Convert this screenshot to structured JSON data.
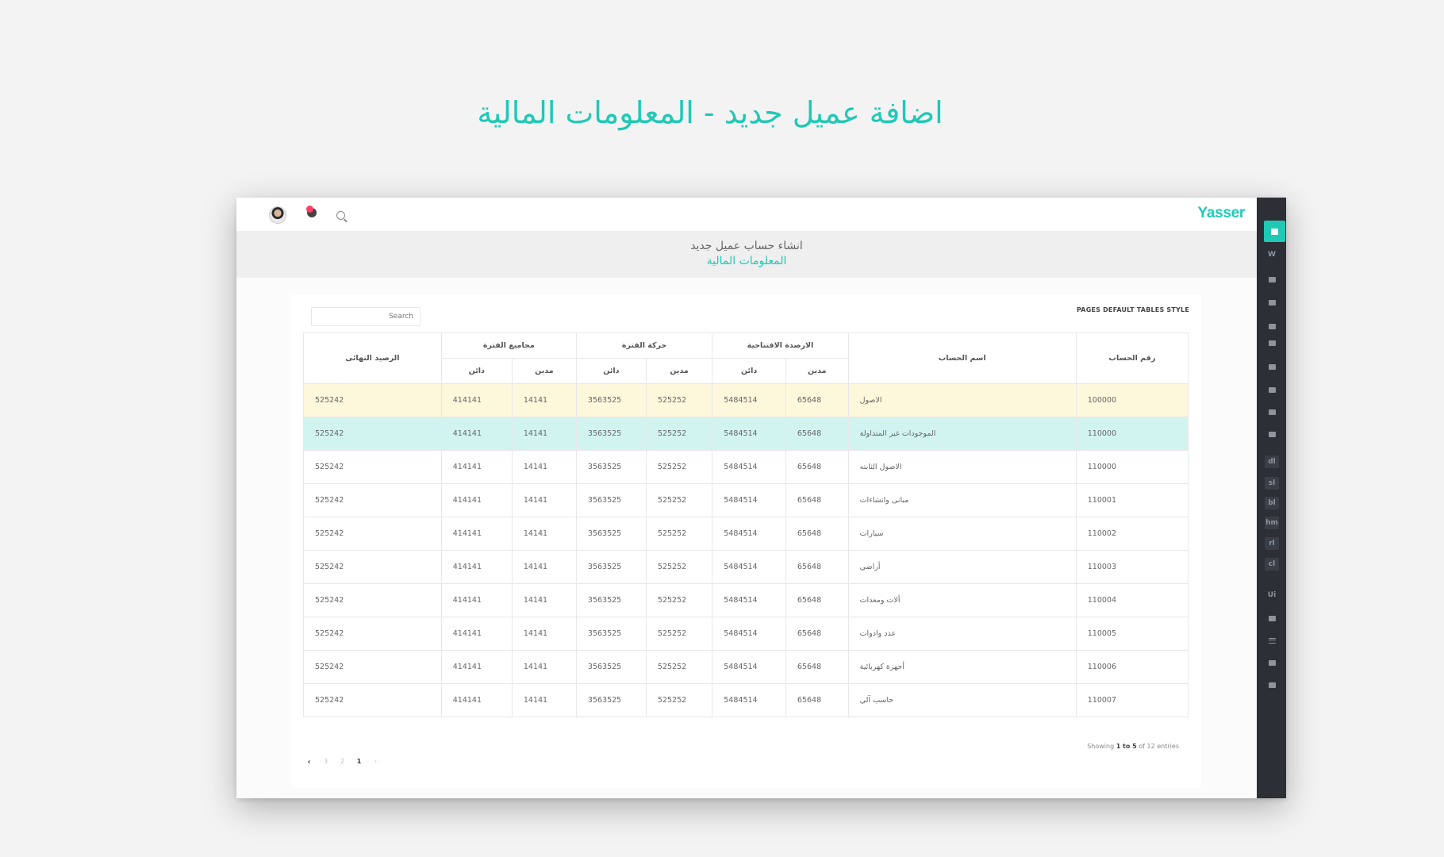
{
  "showcase_title": "اضافة عميل جديد - المعلومات المالية",
  "app": {
    "brand": "Yasser",
    "page_heading": "انشاء حساب عميل جديد",
    "page_subheading": "المعلومات المالية"
  },
  "sidebar": {
    "items": [
      {
        "name": "home-icon",
        "label": "",
        "active": true
      },
      {
        "name": "widgets-icon",
        "label": "W"
      },
      {
        "name": "mail-icon",
        "label": ""
      },
      {
        "name": "card-icon",
        "label": ""
      },
      {
        "name": "calendar-icon",
        "label": ""
      },
      {
        "name": "mail-icon-2",
        "label": ""
      },
      {
        "name": "card-icon-2",
        "label": ""
      },
      {
        "name": "calendar-icon-2",
        "label": ""
      },
      {
        "name": "gallery-icon",
        "label": ""
      },
      {
        "name": "layout-icon",
        "label": ""
      },
      {
        "name": "dl-item",
        "label": "dl"
      },
      {
        "name": "sl-item",
        "label": "sl"
      },
      {
        "name": "bl-item",
        "label": "bl"
      },
      {
        "name": "hm-item",
        "label": "hm"
      },
      {
        "name": "rl-item",
        "label": "rl"
      },
      {
        "name": "cl-item",
        "label": "cl"
      },
      {
        "name": "ui-item",
        "label": "Ui"
      },
      {
        "name": "document-icon",
        "label": ""
      },
      {
        "name": "menu-icon",
        "label": ""
      },
      {
        "name": "window-icon",
        "label": ""
      },
      {
        "name": "table-icon",
        "label": ""
      }
    ]
  },
  "card": {
    "title": "PAGES DEFAULT TABLES STYLE",
    "search_placeholder": "Search"
  },
  "table": {
    "headers": {
      "account_no": "رقم الحساب",
      "account_name": "اسم الحساب",
      "opening": "الارصدة الافتتاحية",
      "movement": "حركة الفترة",
      "totals": "مجاميع الفترة",
      "final": "الرصيد النهائى",
      "debit": "مدين",
      "credit": "دائن"
    },
    "rows": [
      {
        "no": "100000",
        "name": "الاصول",
        "od": "65648",
        "oc": "5484514",
        "md": "525252",
        "mc": "3563525",
        "td": "14141",
        "tc": "414141",
        "final": "525242",
        "style": "row-yellow"
      },
      {
        "no": "110000",
        "name": "الموجودات غير المتداولة",
        "od": "65648",
        "oc": "5484514",
        "md": "525252",
        "mc": "3563525",
        "td": "14141",
        "tc": "414141",
        "final": "525242",
        "style": "row-teal"
      },
      {
        "no": "110000",
        "name": "الاصول الثابته",
        "od": "65648",
        "oc": "5484514",
        "md": "525252",
        "mc": "3563525",
        "td": "14141",
        "tc": "414141",
        "final": "525242",
        "style": ""
      },
      {
        "no": "110001",
        "name": "مبانى وانشاءات",
        "od": "65648",
        "oc": "5484514",
        "md": "525252",
        "mc": "3563525",
        "td": "14141",
        "tc": "414141",
        "final": "525242",
        "style": ""
      },
      {
        "no": "110002",
        "name": "سيارات",
        "od": "65648",
        "oc": "5484514",
        "md": "525252",
        "mc": "3563525",
        "td": "14141",
        "tc": "414141",
        "final": "525242",
        "style": ""
      },
      {
        "no": "110003",
        "name": "أراضي",
        "od": "65648",
        "oc": "5484514",
        "md": "525252",
        "mc": "3563525",
        "td": "14141",
        "tc": "414141",
        "final": "525242",
        "style": ""
      },
      {
        "no": "110004",
        "name": "ألات ومعدات",
        "od": "65648",
        "oc": "5484514",
        "md": "525252",
        "mc": "3563525",
        "td": "14141",
        "tc": "414141",
        "final": "525242",
        "style": ""
      },
      {
        "no": "110005",
        "name": "عدد وادوات",
        "od": "65648",
        "oc": "5484514",
        "md": "525252",
        "mc": "3563525",
        "td": "14141",
        "tc": "414141",
        "final": "525242",
        "style": ""
      },
      {
        "no": "110006",
        "name": "أجهزة كهربائية",
        "od": "65648",
        "oc": "5484514",
        "md": "525252",
        "mc": "3563525",
        "td": "14141",
        "tc": "414141",
        "final": "525242",
        "style": ""
      },
      {
        "no": "110007",
        "name": "حاسب آلي",
        "od": "65648",
        "oc": "5484514",
        "md": "525252",
        "mc": "3563525",
        "td": "14141",
        "tc": "414141",
        "final": "525242",
        "style": ""
      }
    ]
  },
  "footer": {
    "showing_prefix": "Showing",
    "showing_range": "1 to 5",
    "showing_suffix": "of 12 entries"
  },
  "pagination": {
    "prev": "‹",
    "pages": [
      "3",
      "2",
      "1"
    ],
    "current": "1",
    "next": "›"
  },
  "colors": {
    "accent": "#1fc9b6",
    "sidebar": "#2c2f36",
    "row_highlight_yellow": "#fdf7dc",
    "row_highlight_teal": "#d2f4f1",
    "notification": "#ff3e6c"
  }
}
